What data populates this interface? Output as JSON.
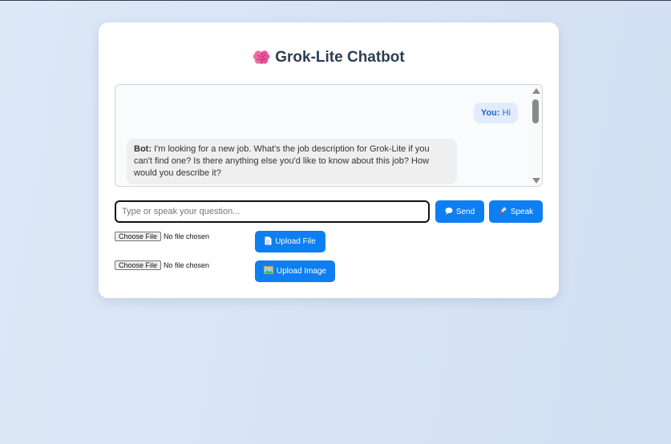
{
  "app": {
    "title": "Grok-Lite Chatbot",
    "title_icon": "brain-icon"
  },
  "chat": {
    "messages": [
      {
        "role": "user",
        "speaker": "You:",
        "text": "Hi"
      },
      {
        "role": "bot",
        "speaker": "Bot:",
        "text": "I'm looking for a new job. What's the job description for Grok-Lite if you can't find one? Is there anything else you'd like to know about this job? How would you describe it?"
      }
    ]
  },
  "input": {
    "placeholder": "Type or speak your question...",
    "value": ""
  },
  "buttons": {
    "send": {
      "label": "Send",
      "icon": "speech-bubble-icon"
    },
    "speak": {
      "label": "Speak",
      "icon": "microphone-icon"
    },
    "upload_file": {
      "label": "Upload File",
      "icon": "document-icon"
    },
    "upload_image": {
      "label": "Upload Image",
      "icon": "picture-icon"
    }
  },
  "file_inputs": [
    {
      "button_label": "Choose File",
      "status": "No file chosen"
    },
    {
      "button_label": "Choose File",
      "status": "No file chosen"
    }
  ],
  "colors": {
    "accent": "#0d7ff2",
    "title": "#2c3e50",
    "user_bubble": "#e1ecfb",
    "bot_bubble": "#efefef"
  }
}
